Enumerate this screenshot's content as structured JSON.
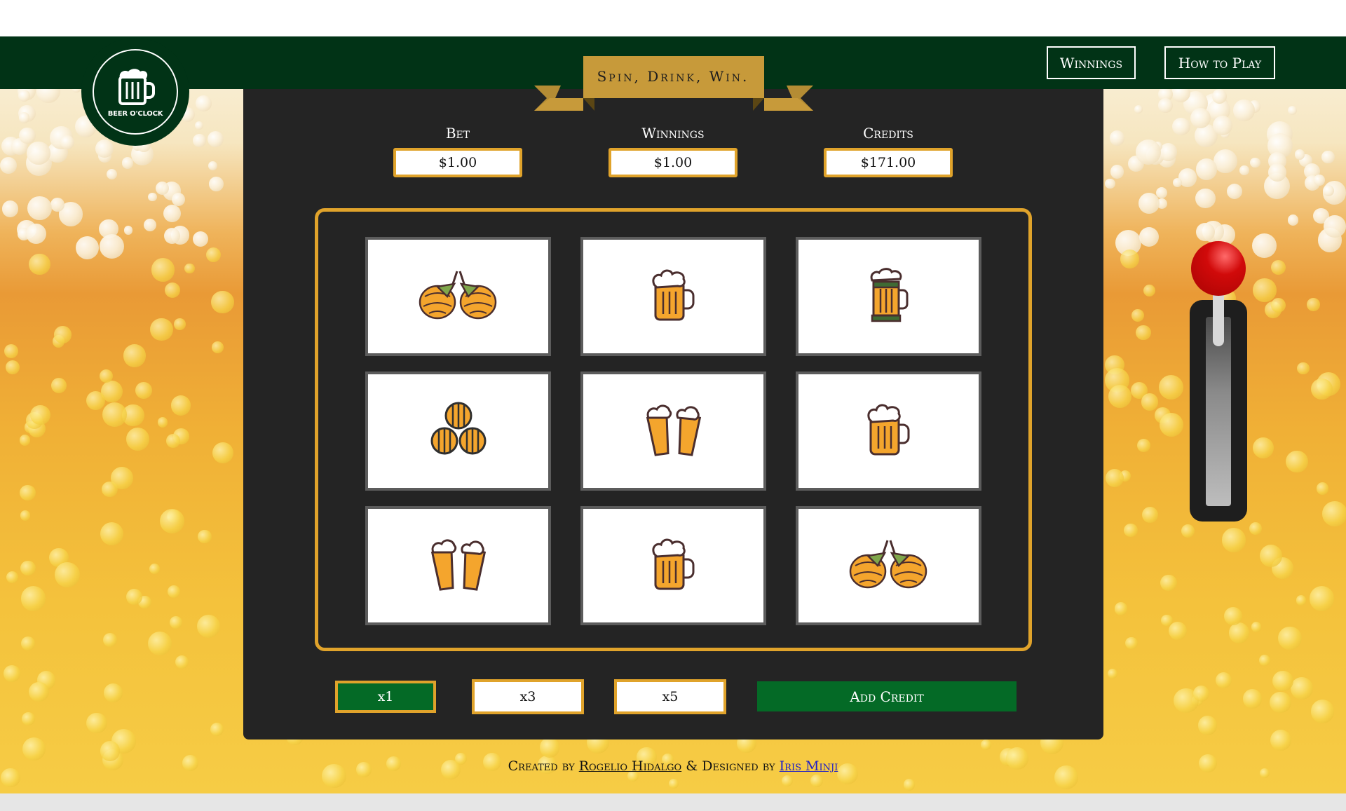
{
  "header": {
    "logo_text": "BEER O'CLOCK",
    "banner": "Spin, Drink, Win.",
    "nav": [
      {
        "label": "Winnings"
      },
      {
        "label": "How to Play"
      }
    ]
  },
  "stats": {
    "bet": {
      "label": "Bet",
      "value": "$1.00"
    },
    "winnings": {
      "label": "Winnings",
      "value": "$1.00"
    },
    "credits": {
      "label": "Credits",
      "value": "$171.00"
    }
  },
  "reels": [
    [
      "hops-icon",
      "beer-mug-icon",
      "stein-icon"
    ],
    [
      "barrels-icon",
      "cheers-icon",
      "beer-mug-icon"
    ],
    [
      "cheers-icon",
      "beer-mug-icon",
      "hops-icon"
    ]
  ],
  "controls": {
    "multipliers": [
      {
        "label": "x1",
        "active": true
      },
      {
        "label": "x3",
        "active": false
      },
      {
        "label": "x5",
        "active": false
      }
    ],
    "add_credit": "Add Credit"
  },
  "footer": {
    "prefix": "Created by",
    "author": "Rogelio Hidalgo",
    "middle": "& Designed by",
    "designer": "Iris Minji"
  },
  "colors": {
    "dark_green": "#013316",
    "button_green": "#046a26",
    "gold": "#e0a32b",
    "machine": "#242424",
    "lever_knob": "#d10a0a"
  }
}
